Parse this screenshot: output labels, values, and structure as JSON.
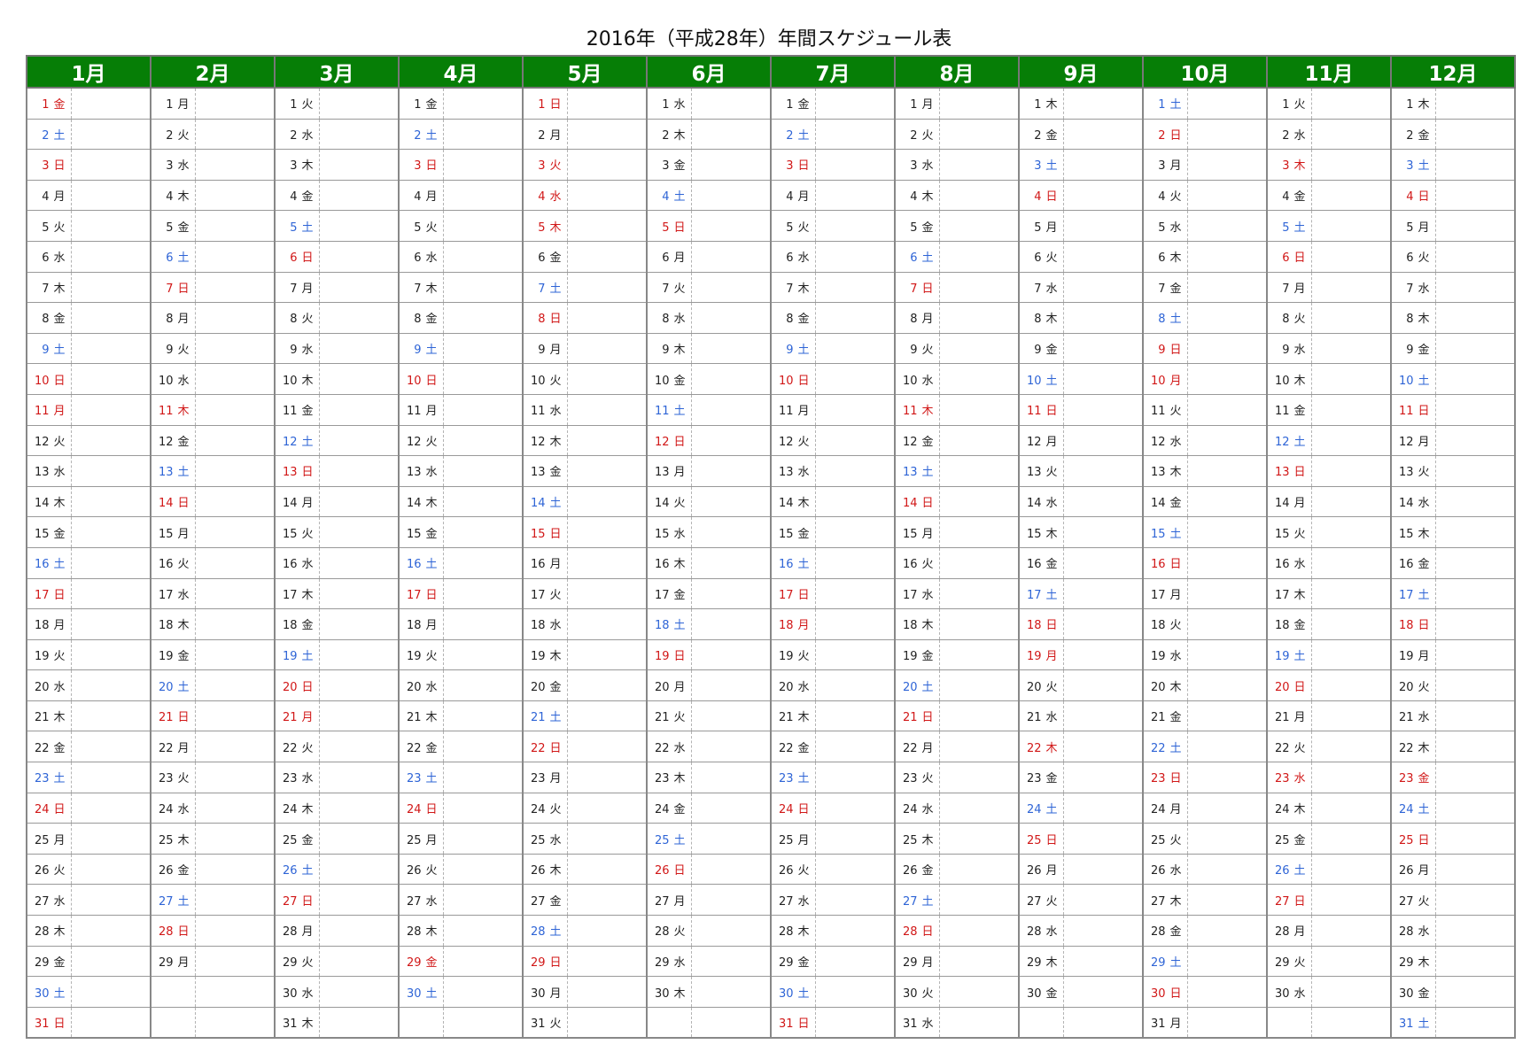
{
  "title": "2016年（平成28年）年間スケジュール表",
  "colors": {
    "header_bg": "#067e06",
    "holiday": "#d11717",
    "saturday": "#2e64d6",
    "weekday": "#222222"
  },
  "months": [
    "1月",
    "2月",
    "3月",
    "4月",
    "5月",
    "6月",
    "7月",
    "8月",
    "9月",
    "10月",
    "11月",
    "12月"
  ],
  "weekdays": [
    "日",
    "月",
    "火",
    "水",
    "木",
    "金",
    "土"
  ],
  "year": 2016,
  "holidays": [
    "1-1",
    "1-11",
    "2-11",
    "3-20",
    "3-21",
    "4-29",
    "5-3",
    "5-4",
    "5-5",
    "7-18",
    "8-11",
    "9-19",
    "9-22",
    "10-10",
    "11-3",
    "11-23",
    "12-23"
  ]
}
